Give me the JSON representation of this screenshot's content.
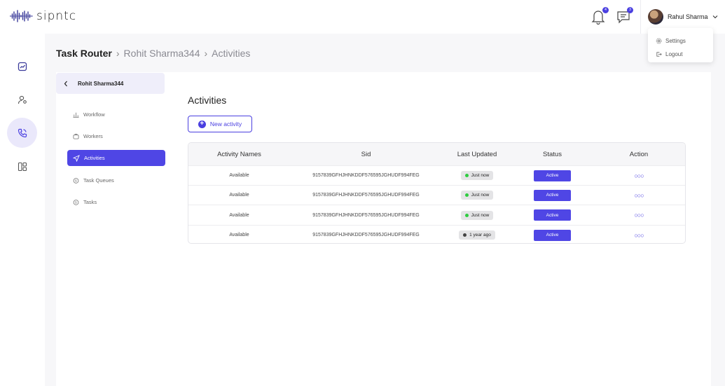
{
  "brand": {
    "name": "sipntc"
  },
  "header": {
    "notifications_count": "4",
    "messages_count": "3",
    "user_name": "Rahul Sharma",
    "menu": [
      {
        "label": "Settings",
        "icon": "gear-icon"
      },
      {
        "label": "Logout",
        "icon": "logout-icon"
      }
    ]
  },
  "breadcrumb": {
    "first": "Task Router",
    "second": "Rohit Sharma344",
    "third": "Activities"
  },
  "subpanel": {
    "title": "Rohit Sharma344",
    "items": [
      {
        "label": "Workflow",
        "icon": "workflow-icon"
      },
      {
        "label": "Workers",
        "icon": "workers-icon"
      },
      {
        "label": "Activities",
        "icon": "activities-icon",
        "active": true
      },
      {
        "label": "Task Queues",
        "icon": "task-queues-icon"
      },
      {
        "label": "Tasks",
        "icon": "tasks-icon"
      }
    ]
  },
  "main": {
    "title": "Activities",
    "new_button": "New activity"
  },
  "table": {
    "columns": [
      "Activity Names",
      "Sid",
      "Last Updated",
      "Status",
      "Action"
    ],
    "rows": [
      {
        "name": "Available",
        "sid": "9157839GFHJHNKDDF576595JGHUDF994FEG",
        "updated": "Just now",
        "updated_color": "#2ecc40",
        "status": "Active"
      },
      {
        "name": "Available",
        "sid": "9157839GFHJHNKDDF576595JGHUDF994FEG",
        "updated": "Just now",
        "updated_color": "#2ecc40",
        "status": "Active"
      },
      {
        "name": "Available",
        "sid": "9157839GFHJHNKDDF576595JGHUDF994FEG",
        "updated": "Just now",
        "updated_color": "#2ecc40",
        "status": "Active"
      },
      {
        "name": "Available",
        "sid": "9157839GFHJHNKDDF576595JGHUDF994FEG",
        "updated": "1 year ago",
        "updated_color": "#444444",
        "status": "Active"
      }
    ]
  },
  "colors": {
    "accent": "#4f46e5",
    "accent_light": "#eae8fb"
  }
}
